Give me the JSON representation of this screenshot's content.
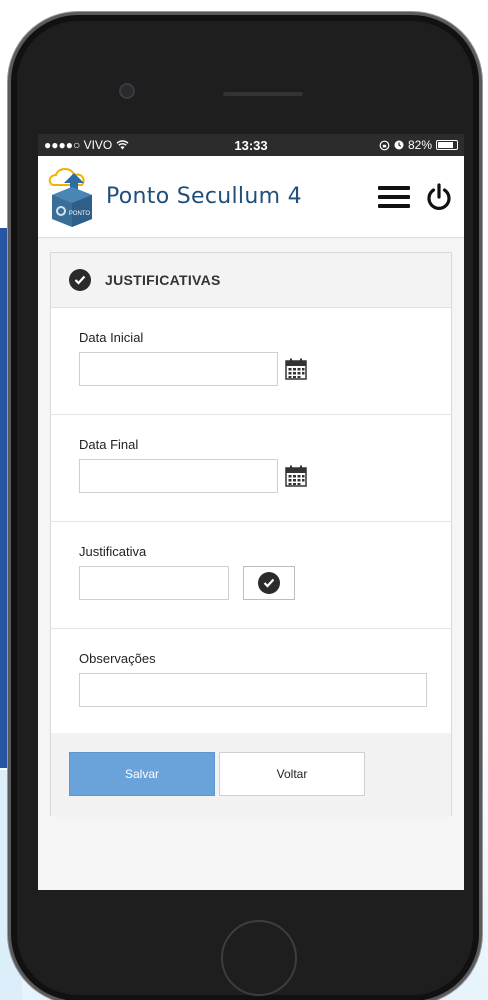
{
  "status_bar": {
    "carrier": "●●●●○ VIVO",
    "time": "13:33",
    "battery": "82%",
    "battery_level": 0.82
  },
  "app": {
    "title": "Ponto Secullum 4",
    "logo_badge": "PONTO 4"
  },
  "panel": {
    "title": "JUSTIFICATIVAS"
  },
  "form": {
    "data_inicial_label": "Data Inicial",
    "data_inicial_value": "",
    "data_final_label": "Data Final",
    "data_final_value": "",
    "justificativa_label": "Justificativa",
    "justificativa_value": "",
    "observacoes_label": "Observações",
    "observacoes_value": ""
  },
  "buttons": {
    "save": "Salvar",
    "back": "Voltar"
  },
  "colors": {
    "primary": "#6aa3da",
    "title": "#1f4f7a",
    "dark": "#2b2b2b"
  }
}
